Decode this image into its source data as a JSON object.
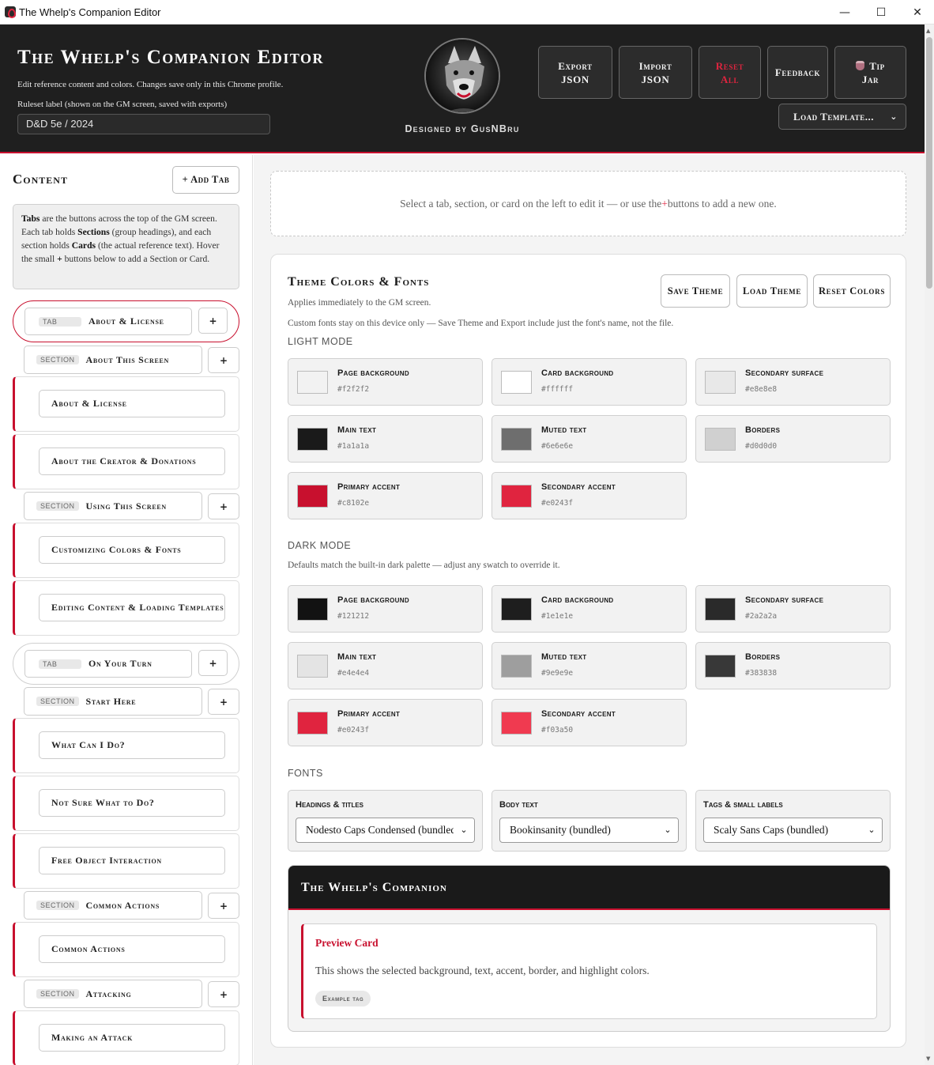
{
  "window": {
    "title": "The Whelp's Companion Editor",
    "minimize": "—",
    "maximize": "☐",
    "close": "✕"
  },
  "header": {
    "title": "The Whelp's Companion Editor",
    "subtitle": "Edit reference content and colors. Changes save only in this Chrome profile.",
    "ruleset_label": "Ruleset label (shown on the GM screen, saved with exports)",
    "ruleset_value": "D&D 5e / 2024",
    "designed_by": "Designed by GusNBru",
    "buttons": {
      "export_line1": "Export",
      "export_line2": "JSON",
      "import_line1": "Import",
      "import_line2": "JSON",
      "reset_line1": "Reset",
      "reset_line2": "All",
      "feedback": "Feedback",
      "tip_line1": "Tip",
      "tip_line2": "Jar"
    },
    "load_template": "Load Template..."
  },
  "sidebar": {
    "title": "Content",
    "add_tab": "+ Add Tab",
    "help": {
      "t1": "Tabs",
      "p1": " are the buttons across the top of the GM screen. Each tab holds ",
      "t2": "Sections",
      "p2": " (group headings), and each section holds ",
      "t3": "Cards",
      "p3": " (the actual reference text). Hover the small ",
      "t4": "+",
      "p4": " buttons below to add a Section or Card."
    },
    "tag_tab": "Tab",
    "tag_section": "Section",
    "plus": "+",
    "items": [
      {
        "kind": "tab",
        "label": "About & License",
        "active": true
      },
      {
        "kind": "section",
        "label": "About This Screen"
      },
      {
        "kind": "card",
        "label": "About & License"
      },
      {
        "kind": "card",
        "label": "About the Creator & Donations"
      },
      {
        "kind": "section",
        "label": "Using This Screen"
      },
      {
        "kind": "card",
        "label": "Customizing Colors & Fonts"
      },
      {
        "kind": "card",
        "label": "Editing Content & Loading Templates"
      },
      {
        "kind": "tab",
        "label": "On Your Turn"
      },
      {
        "kind": "section",
        "label": "Start Here"
      },
      {
        "kind": "card",
        "label": "What Can I Do?"
      },
      {
        "kind": "card",
        "label": "Not Sure What to Do?"
      },
      {
        "kind": "card",
        "label": "Free Object Interaction"
      },
      {
        "kind": "section",
        "label": "Common Actions"
      },
      {
        "kind": "card",
        "label": "Common Actions"
      },
      {
        "kind": "section",
        "label": "Attacking"
      },
      {
        "kind": "card",
        "label": "Making an Attack"
      }
    ]
  },
  "main": {
    "hint_a": "Select a tab, section, or card on the left to edit it — or use the ",
    "hint_plus": "+",
    "hint_b": " buttons to add a new one.",
    "panel": {
      "title": "Theme Colors & Fonts",
      "subtitle": "Applies immediately to the GM screen.",
      "note": "Custom fonts stay on this device only — Save Theme and Export include just the font's name, not the file.",
      "save_theme": "Save Theme",
      "load_theme": "Load Theme",
      "reset_colors": "Reset Colors",
      "light_heading": "Light Mode",
      "light": [
        {
          "label": "Page background",
          "hex": "#f2f2f2"
        },
        {
          "label": "Card background",
          "hex": "#ffffff"
        },
        {
          "label": "Secondary surface",
          "hex": "#e8e8e8"
        },
        {
          "label": "Main text",
          "hex": "#1a1a1a"
        },
        {
          "label": "Muted text",
          "hex": "#6e6e6e"
        },
        {
          "label": "Borders",
          "hex": "#d0d0d0"
        },
        {
          "label": "Primary accent",
          "hex": "#c8102e"
        },
        {
          "label": "Secondary accent",
          "hex": "#e0243f"
        }
      ],
      "dark_heading": "Dark Mode",
      "dark_desc": "Defaults match the built-in dark palette — adjust any swatch to override it.",
      "dark": [
        {
          "label": "Page background",
          "hex": "#121212"
        },
        {
          "label": "Card background",
          "hex": "#1e1e1e"
        },
        {
          "label": "Secondary surface",
          "hex": "#2a2a2a"
        },
        {
          "label": "Main text",
          "hex": "#e4e4e4"
        },
        {
          "label": "Muted text",
          "hex": "#9e9e9e"
        },
        {
          "label": "Borders",
          "hex": "#383838"
        },
        {
          "label": "Primary accent",
          "hex": "#e0243f"
        },
        {
          "label": "Secondary accent",
          "hex": "#f03a50"
        }
      ],
      "fonts_heading": "Fonts",
      "fonts": [
        {
          "label": "Headings & titles",
          "value": "Nodesto Caps Condensed (bundled)"
        },
        {
          "label": "Body text",
          "value": "Bookinsanity (bundled)"
        },
        {
          "label": "Tags & small labels",
          "value": "Scaly Sans Caps (bundled)"
        }
      ],
      "preview": {
        "header": "The Whelp's Companion",
        "card_title": "Preview Card",
        "card_body": "This shows the selected background, text, accent, border, and highlight colors.",
        "card_tag": "Example tag"
      }
    }
  }
}
